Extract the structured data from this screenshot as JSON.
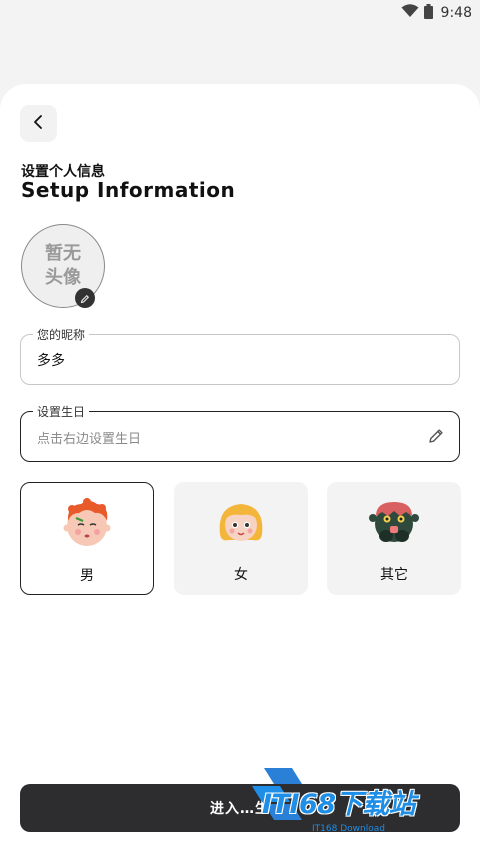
{
  "status_bar": {
    "time": "9:48",
    "wifi_icon": "wifi-icon",
    "battery_icon": "battery-icon"
  },
  "nav": {
    "back_icon": "chevron-left-icon"
  },
  "header": {
    "title_cn": "设置个人信息",
    "title_en": "Setup Information"
  },
  "avatar": {
    "placeholder_text": "暂无头像",
    "edit_icon": "pencil-icon"
  },
  "nickname": {
    "label": "您的昵称",
    "value": "多多"
  },
  "birthday": {
    "label": "设置生日",
    "placeholder": "点击右边设置生日",
    "edit_icon": "pencil-icon"
  },
  "gender": {
    "options": [
      {
        "label": "男",
        "selected": true,
        "icon": "boy-avatar-icon"
      },
      {
        "label": "女",
        "selected": false,
        "icon": "girl-avatar-icon"
      },
      {
        "label": "其它",
        "selected": false,
        "icon": "monster-avatar-icon"
      }
    ]
  },
  "enter_button": {
    "label": "进入…生"
  },
  "watermark": {
    "text": "ITI68下载站",
    "sub": "IT168 Download"
  },
  "colors": {
    "button_dark": "#2d2d2f",
    "card_bg": "#f3f3f3",
    "watermark_blue": "#1e8ee6"
  }
}
